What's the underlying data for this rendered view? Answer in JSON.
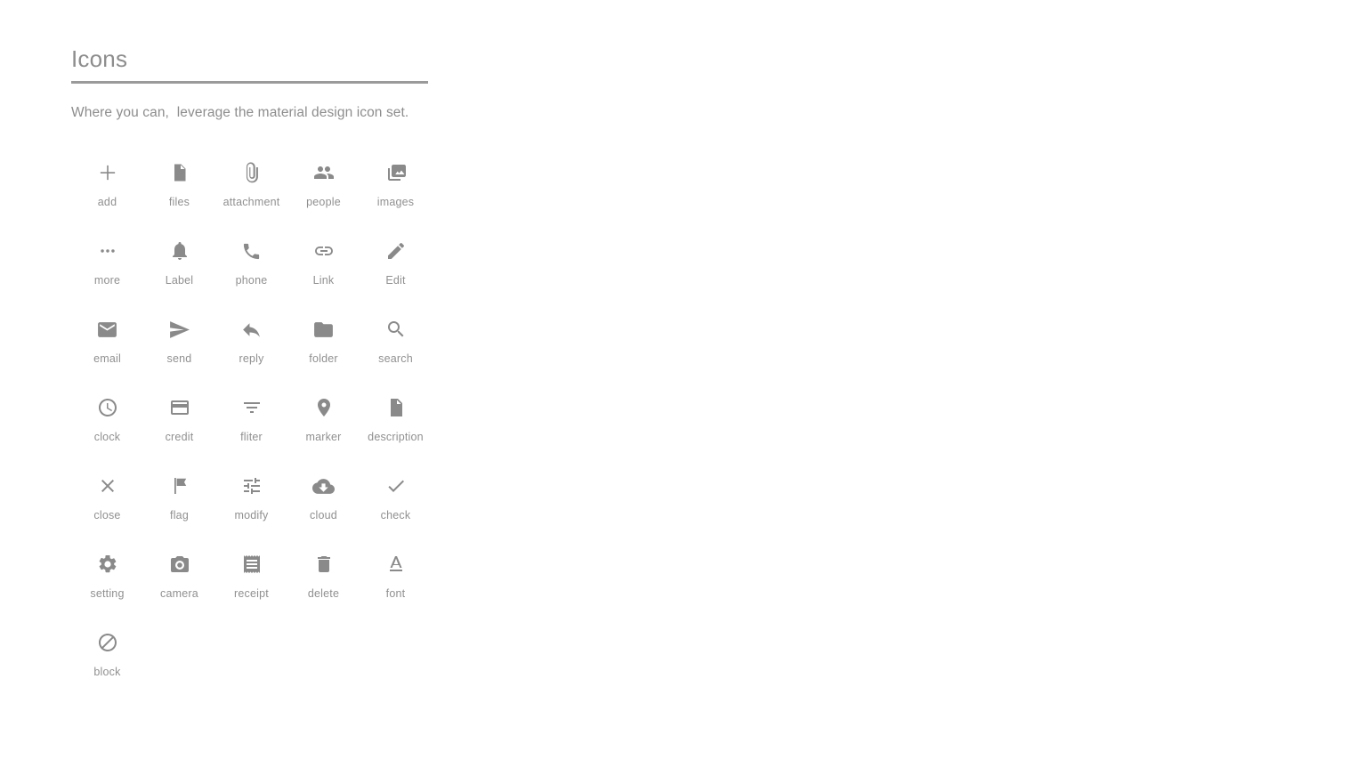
{
  "page": {
    "title": "Icons",
    "subtitle": "Where you can,  leverage the material design icon set."
  },
  "colors": {
    "title": "#8d8d8d",
    "rule": "#9a9a9a",
    "icon": "#8a8a8a",
    "label": "#909090",
    "background": "#ffffff"
  },
  "icons": [
    {
      "label": "add",
      "icon": "add-icon"
    },
    {
      "label": "files",
      "icon": "file-icon"
    },
    {
      "label": "attachment",
      "icon": "attachment-icon"
    },
    {
      "label": "people",
      "icon": "people-icon"
    },
    {
      "label": "images",
      "icon": "photo-library-icon"
    },
    {
      "label": "more",
      "icon": "more-horizontal-icon"
    },
    {
      "label": "Label",
      "icon": "bell-icon"
    },
    {
      "label": "phone",
      "icon": "phone-icon"
    },
    {
      "label": "Link",
      "icon": "link-icon"
    },
    {
      "label": "Edit",
      "icon": "pencil-icon"
    },
    {
      "label": "email",
      "icon": "envelope-icon"
    },
    {
      "label": "send",
      "icon": "send-icon"
    },
    {
      "label": "reply",
      "icon": "reply-icon"
    },
    {
      "label": "folder",
      "icon": "folder-icon"
    },
    {
      "label": "search",
      "icon": "search-icon"
    },
    {
      "label": "clock",
      "icon": "clock-icon"
    },
    {
      "label": "credit",
      "icon": "credit-card-icon"
    },
    {
      "label": "fliter",
      "icon": "filter-list-icon"
    },
    {
      "label": "marker",
      "icon": "map-marker-icon"
    },
    {
      "label": "description",
      "icon": "description-icon"
    },
    {
      "label": "close",
      "icon": "close-icon"
    },
    {
      "label": "flag",
      "icon": "flag-icon"
    },
    {
      "label": "modify",
      "icon": "tune-icon"
    },
    {
      "label": "cloud",
      "icon": "cloud-download-icon"
    },
    {
      "label": "check",
      "icon": "check-icon"
    },
    {
      "label": "setting",
      "icon": "gear-icon"
    },
    {
      "label": "camera",
      "icon": "camera-icon"
    },
    {
      "label": "receipt",
      "icon": "receipt-icon"
    },
    {
      "label": "delete",
      "icon": "trash-icon"
    },
    {
      "label": "font",
      "icon": "font-format-icon"
    },
    {
      "label": "block",
      "icon": "block-icon"
    }
  ]
}
